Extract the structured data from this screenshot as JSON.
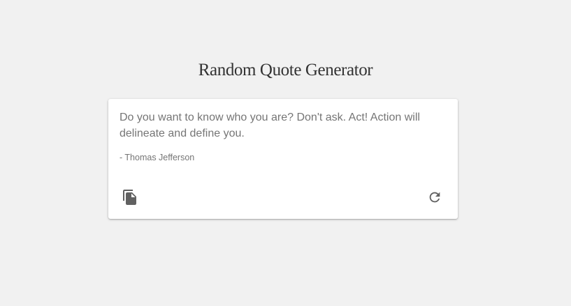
{
  "header": {
    "title": "Random Quote Generator"
  },
  "quote": {
    "text": "Do you want to know who you are? Don't ask. Act! Action will delineate and define you.",
    "author": "- Thomas Jefferson"
  },
  "actions": {
    "copy_icon": "copy-icon",
    "refresh_icon": "refresh-icon"
  },
  "colors": {
    "background": "#f1f1f1",
    "card": "#ffffff",
    "title": "#333333",
    "text": "#757575",
    "icon": "#616161"
  }
}
